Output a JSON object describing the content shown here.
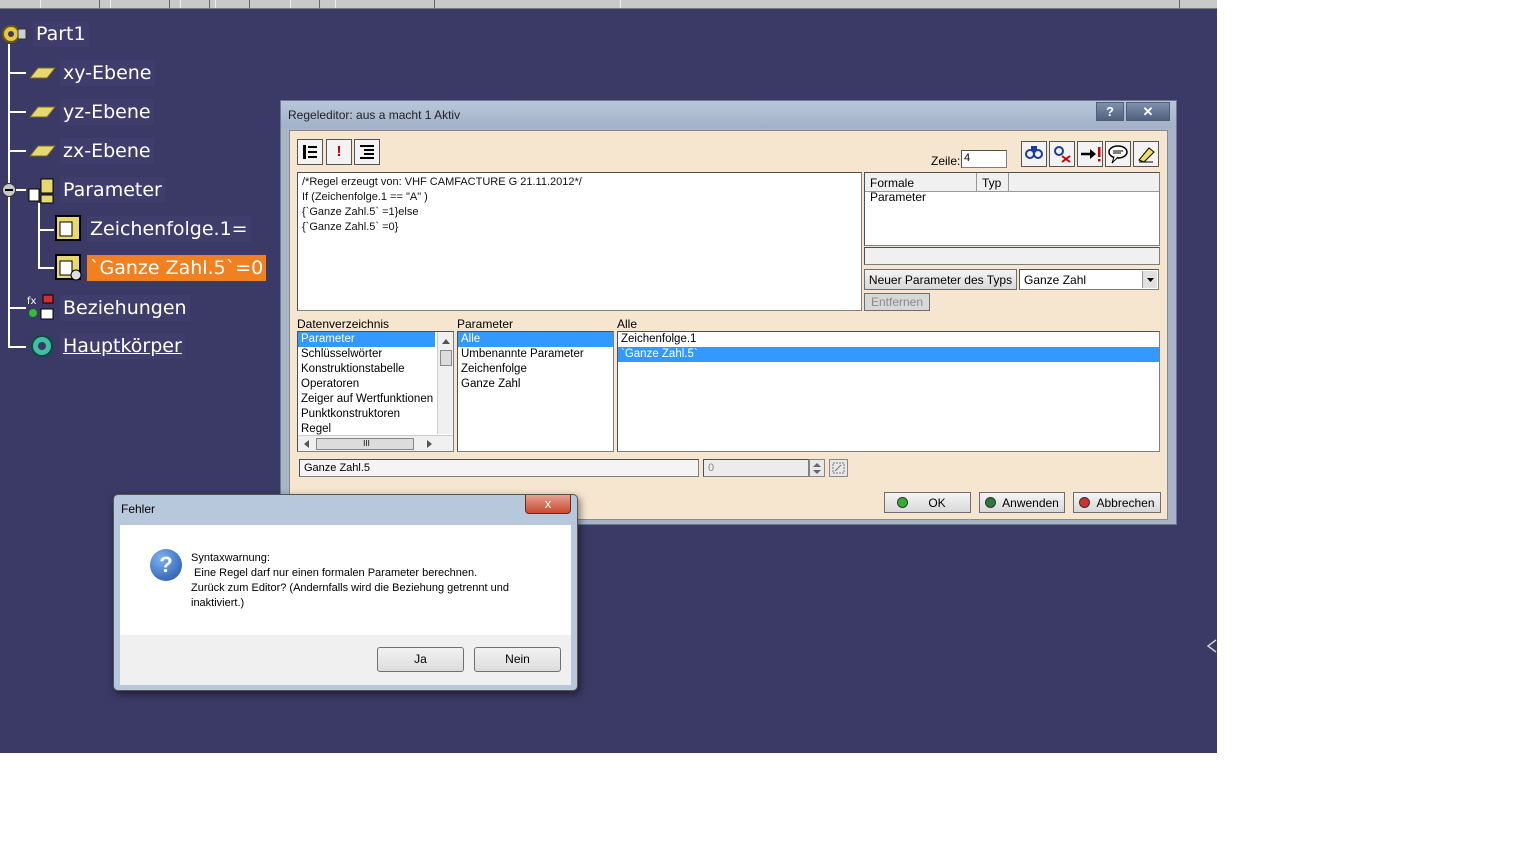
{
  "tree": {
    "root": "Part1",
    "items": [
      {
        "label": "xy-Ebene"
      },
      {
        "label": "yz-Ebene"
      },
      {
        "label": "zx-Ebene"
      },
      {
        "label": "Parameter"
      },
      {
        "label": "Zeichenfolge.1="
      },
      {
        "label": "`Ganze Zahl.5`=0"
      },
      {
        "label": "Beziehungen"
      },
      {
        "label": "Hauptkörper"
      }
    ]
  },
  "rule_editor": {
    "title": "Regeleditor: aus a macht 1 Aktiv",
    "help": "?",
    "close": "✕",
    "zeile_label": "Zeile:",
    "zeile_value": "4",
    "code_lines": [
      "/*Regel erzeugt von: VHF CAMFACTURE G 21.11.2012*/",
      "If (Zeichenfolge.1 == \"A\" )",
      "{`Ganze Zahl.5` =1}else",
      "{`Ganze Zahl.5` =0}"
    ],
    "formal_params_header": [
      "Formale Parameter",
      "Typ"
    ],
    "new_param_button": "Neuer Parameter des Typs",
    "type_select": "Ganze Zahl",
    "remove_button": "Entfernen",
    "col_dir": "Datenverzeichnis",
    "col_param": "Parameter",
    "col_all": "Alle",
    "dir_items": [
      "Parameter",
      "Schlüsselwörter",
      "Konstruktionstabelle",
      "Operatoren",
      "Zeiger auf Wertfunktionen",
      "Punktkonstruktoren",
      "Regel"
    ],
    "param_items": [
      "Alle",
      "Umbenannte Parameter",
      "Zeichenfolge",
      "Ganze Zahl"
    ],
    "all_items": [
      "Zeichenfolge.1",
      "`Ganze Zahl.5`"
    ],
    "name_field": "Ganze Zahl.5",
    "value_field": "0",
    "ok": "OK",
    "apply": "Anwenden",
    "cancel": "Abbrechen",
    "scroll_thumb": "III"
  },
  "error_dialog": {
    "title": "Fehler",
    "close": "x",
    "icon": "?",
    "lines": [
      "Syntaxwarnung:",
      " Eine Regel darf nur einen formalen Parameter berechnen.",
      "Zurück zum Editor? (Andernfalls wird die Beziehung getrennt und",
      "inaktiviert.)"
    ],
    "yes": "Ja",
    "no": "Nein"
  },
  "colors": {
    "workspace": "#3b3a66",
    "selection": "#f08020",
    "dialog_body": "#f6e6cf",
    "list_highlight": "#3399ff"
  }
}
